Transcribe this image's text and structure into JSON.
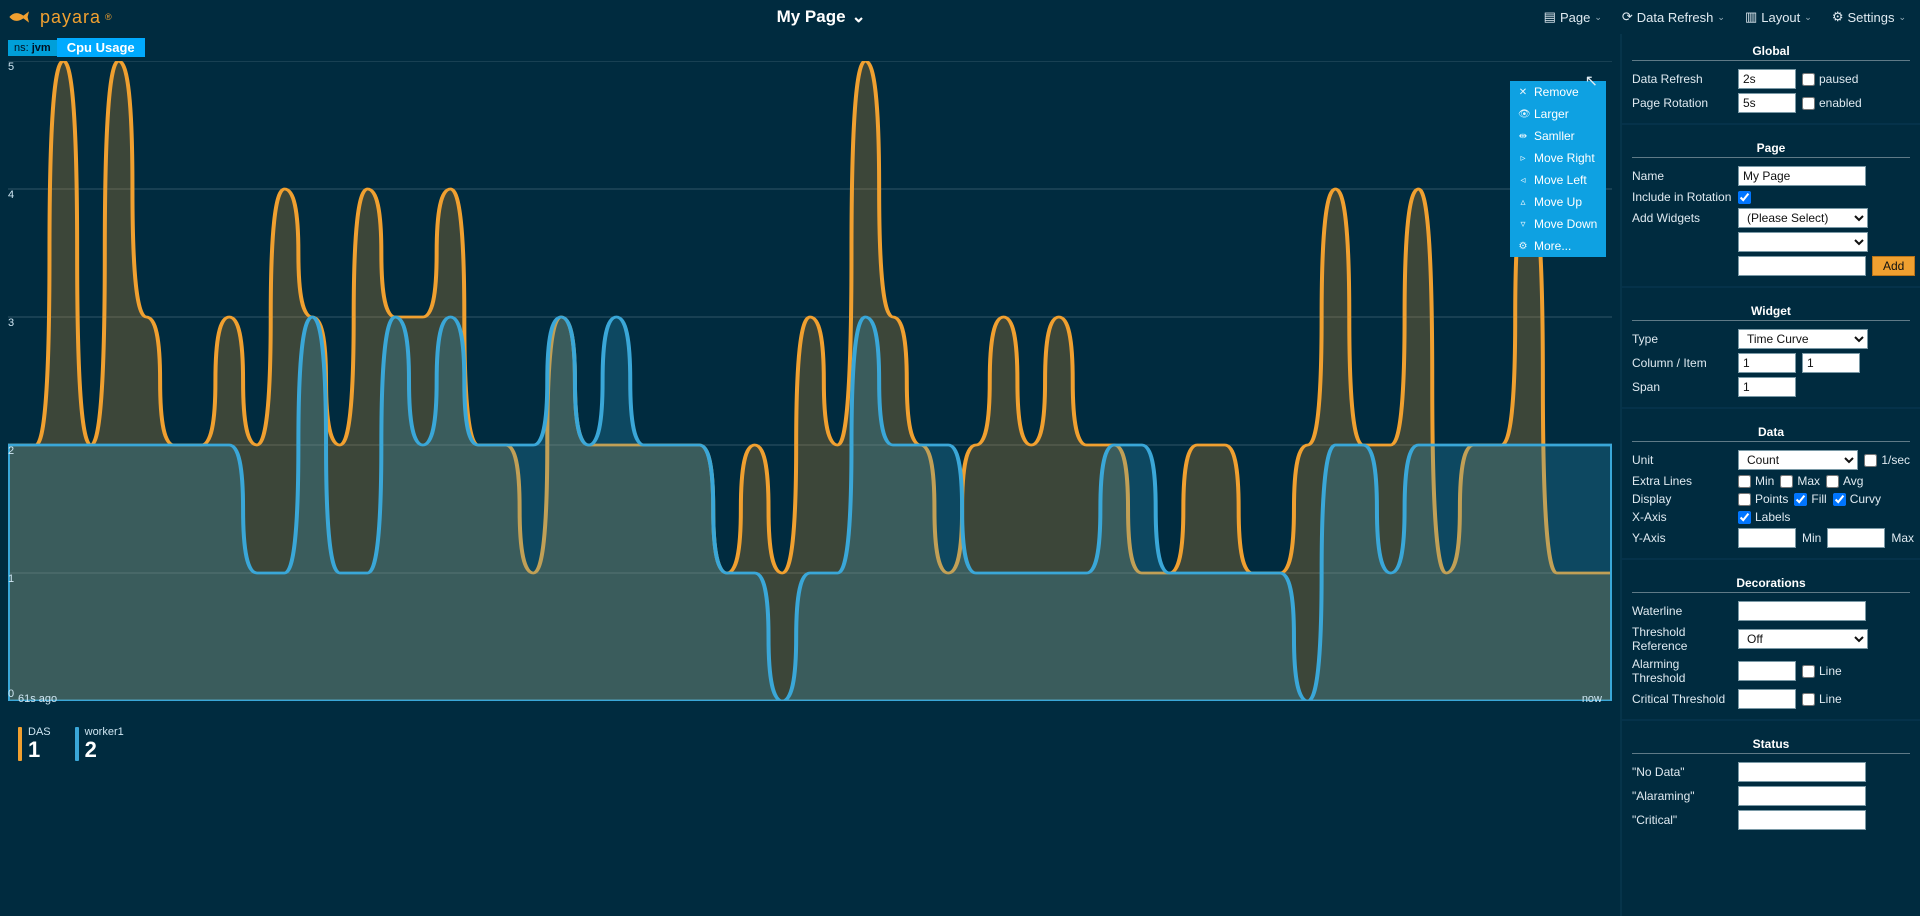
{
  "brand": "payara",
  "page_title": "My Page",
  "nav": {
    "page": "Page",
    "data_refresh": "Data Refresh",
    "layout": "Layout",
    "settings": "Settings"
  },
  "chart_header": {
    "ns_prefix": "ns:",
    "ns_value": "jvm",
    "title": "Cpu Usage"
  },
  "context_menu": {
    "remove": "Remove",
    "larger": "Larger",
    "smaller": "Samller",
    "move_right": "Move Right",
    "move_left": "Move Left",
    "move_up": "Move Up",
    "move_down": "Move Down",
    "more": "More..."
  },
  "x_axis": {
    "left": "61s ago",
    "right": "now"
  },
  "legend": {
    "das": {
      "name": "DAS",
      "value": "1",
      "color": "#f0a030"
    },
    "worker": {
      "name": "worker1",
      "value": "2",
      "color": "#3aa7d8"
    }
  },
  "side": {
    "global": {
      "title": "Global",
      "data_refresh_lbl": "Data Refresh",
      "data_refresh_val": "2s",
      "paused_lbl": "paused",
      "page_rotation_lbl": "Page Rotation",
      "page_rotation_val": "5s",
      "enabled_lbl": "enabled"
    },
    "page": {
      "title": "Page",
      "name_lbl": "Name",
      "name_val": "My Page",
      "incl_lbl": "Include in Rotation",
      "incl_checked": true,
      "add_lbl": "Add Widgets",
      "select_placeholder": "(Please Select)",
      "add_btn": "Add"
    },
    "widget": {
      "title": "Widget",
      "type_lbl": "Type",
      "type_val": "Time Curve",
      "ci_lbl": "Column / Item",
      "col_val": "1",
      "item_val": "1",
      "span_lbl": "Span",
      "span_val": "1"
    },
    "data": {
      "title": "Data",
      "unit_lbl": "Unit",
      "unit_val": "Count",
      "per_sec": "1/sec",
      "extra_lbl": "Extra Lines",
      "min": "Min",
      "max": "Max",
      "avg": "Avg",
      "display_lbl": "Display",
      "points": "Points",
      "fill": "Fill",
      "curvy": "Curvy",
      "xaxis_lbl": "X-Axis",
      "labels": "Labels",
      "yaxis_lbl": "Y-Axis",
      "y_min": "Min",
      "y_max": "Max"
    },
    "deco": {
      "title": "Decorations",
      "waterline_lbl": "Waterline",
      "thresh_ref_lbl": "Threshold Reference",
      "thresh_ref_val": "Off",
      "alarm_lbl": "Alarming Threshold",
      "line": "Line",
      "crit_lbl": "Critical Threshold"
    },
    "status": {
      "title": "Status",
      "no_data": "\"No Data\"",
      "alarming": "\"Alaraming\"",
      "critical": "\"Critical\""
    }
  },
  "chart_data": {
    "type": "line",
    "title": "Cpu Usage",
    "xlabel": "",
    "ylabel": "",
    "ylim": [
      0,
      5
    ],
    "y_ticks": [
      0,
      1,
      2,
      3,
      4,
      5
    ],
    "x_range": [
      "61s ago",
      "now"
    ],
    "series": [
      {
        "name": "DAS",
        "color": "#f0a030",
        "values": [
          2,
          2,
          5,
          2,
          5,
          3,
          2,
          2,
          3,
          2,
          4,
          3,
          2,
          4,
          3,
          3,
          4,
          2,
          2,
          1,
          3,
          2,
          2,
          2,
          2,
          2,
          1,
          2,
          1,
          3,
          2,
          5,
          3,
          2,
          1,
          2,
          3,
          2,
          3,
          2,
          2,
          1,
          1,
          2,
          2,
          1,
          1,
          2,
          4,
          2,
          2,
          4,
          1,
          2,
          2,
          4,
          1,
          1,
          1
        ]
      },
      {
        "name": "worker1",
        "color": "#3aa7d8",
        "values": [
          2,
          2,
          2,
          2,
          2,
          2,
          2,
          2,
          2,
          1,
          1,
          3,
          1,
          1,
          3,
          2,
          3,
          2,
          2,
          2,
          3,
          2,
          3,
          2,
          2,
          2,
          1,
          1,
          0,
          1,
          1,
          3,
          2,
          2,
          2,
          1,
          1,
          1,
          1,
          1,
          2,
          2,
          1,
          1,
          1,
          1,
          1,
          0,
          2,
          2,
          1,
          2,
          2,
          2,
          2,
          2,
          2,
          2,
          2
        ]
      }
    ]
  }
}
